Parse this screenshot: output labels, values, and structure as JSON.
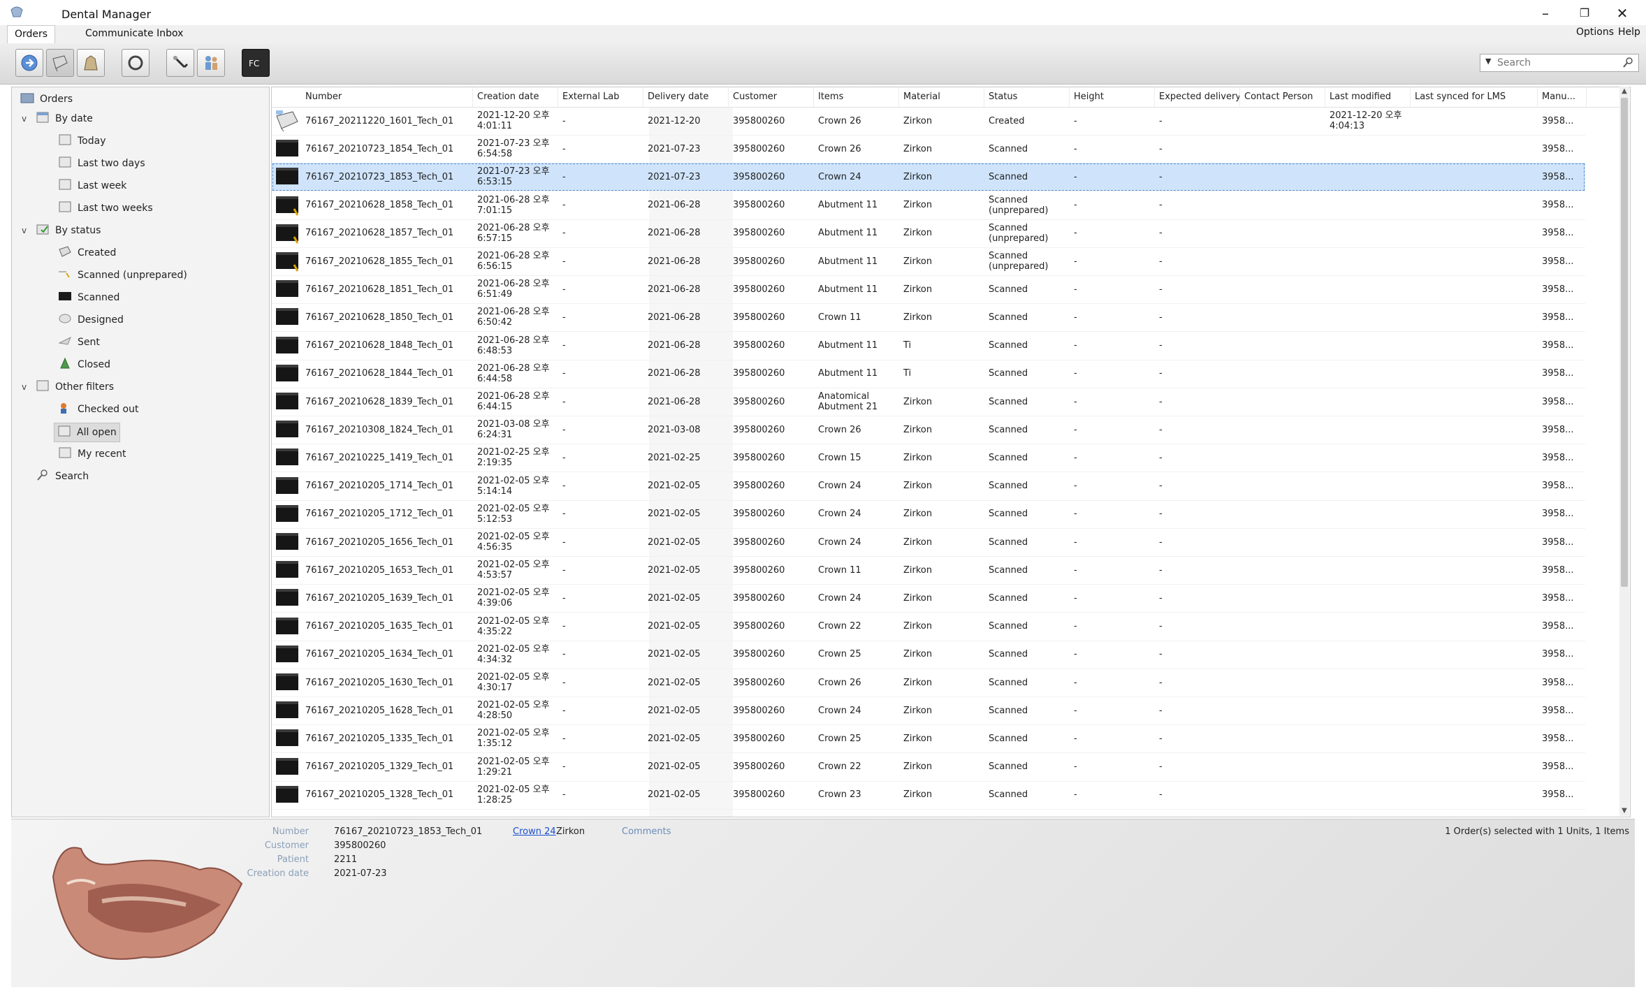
{
  "app": {
    "title": "Dental Manager"
  },
  "tabs": [
    {
      "label": "Orders"
    },
    {
      "label": "Communicate Inbox"
    }
  ],
  "menu_right": [
    {
      "label": "Options"
    },
    {
      "label": "Help"
    }
  ],
  "search": {
    "placeholder": "Search"
  },
  "tree": {
    "root": "Orders",
    "by_date": {
      "label": "By date",
      "items": [
        "Today",
        "Last two days",
        "Last week",
        "Last two weeks"
      ]
    },
    "by_status": {
      "label": "By status",
      "items": [
        "Created",
        "Scanned (unprepared)",
        "Scanned",
        "Designed",
        "Sent",
        "Closed"
      ]
    },
    "other_filters": {
      "label": "Other filters",
      "items": [
        "Checked out",
        "All open",
        "My recent"
      ]
    },
    "search": "Search"
  },
  "columns": [
    "Number",
    "Creation date",
    "External Lab",
    "Delivery date",
    "Customer",
    "Items",
    "Material",
    "Status",
    "Height",
    "Expected delivery",
    "Contact Person",
    "Last modified",
    "Last synced for LMS",
    "Manu..."
  ],
  "rows": [
    {
      "number": "76167_20211220_1601_Tech_01",
      "created": "2021-12-20 오후",
      "created_time": "4:01:11",
      "lab": "-",
      "delivery": "2021-12-20",
      "customer": "395800260",
      "items": "Crown 26",
      "items2": "",
      "material": "Zirkon",
      "status": "Created",
      "status2": "",
      "height": "-",
      "expected": "-",
      "modified": "2021-12-20 오후",
      "modified_time": "4:04:13",
      "manu": "3958...",
      "icon": "created"
    },
    {
      "number": "76167_20210723_1854_Tech_01",
      "created": "2021-07-23 오후",
      "created_time": "6:54:58",
      "lab": "-",
      "delivery": "2021-07-23",
      "customer": "395800260",
      "items": "Crown 26",
      "items2": "",
      "material": "Zirkon",
      "status": "Scanned",
      "status2": "",
      "height": "-",
      "expected": "-",
      "modified": "",
      "modified_time": "",
      "manu": "3958...",
      "icon": "scanned"
    },
    {
      "number": "76167_20210723_1853_Tech_01",
      "created": "2021-07-23 오후",
      "created_time": "6:53:15",
      "lab": "-",
      "delivery": "2021-07-23",
      "customer": "395800260",
      "items": "Crown 24",
      "items2": "",
      "material": "Zirkon",
      "status": "Scanned",
      "status2": "",
      "height": "-",
      "expected": "-",
      "modified": "",
      "modified_time": "",
      "manu": "3958...",
      "icon": "scanned",
      "selected": true
    },
    {
      "number": "76167_20210628_1858_Tech_01",
      "created": "2021-06-28 오후",
      "created_time": "7:01:15",
      "lab": "-",
      "delivery": "2021-06-28",
      "customer": "395800260",
      "items": "Abutment 11",
      "items2": "",
      "material": "Zirkon",
      "status": "Scanned",
      "status2": "(unprepared)",
      "height": "-",
      "expected": "-",
      "modified": "",
      "modified_time": "",
      "manu": "3958...",
      "icon": "unprepared"
    },
    {
      "number": "76167_20210628_1857_Tech_01",
      "created": "2021-06-28 오후",
      "created_time": "6:57:15",
      "lab": "-",
      "delivery": "2021-06-28",
      "customer": "395800260",
      "items": "Abutment 11",
      "items2": "",
      "material": "Zirkon",
      "status": "Scanned",
      "status2": "(unprepared)",
      "height": "-",
      "expected": "-",
      "modified": "",
      "modified_time": "",
      "manu": "3958...",
      "icon": "unprepared"
    },
    {
      "number": "76167_20210628_1855_Tech_01",
      "created": "2021-06-28 오후",
      "created_time": "6:56:15",
      "lab": "-",
      "delivery": "2021-06-28",
      "customer": "395800260",
      "items": "Abutment 11",
      "items2": "",
      "material": "Zirkon",
      "status": "Scanned",
      "status2": "(unprepared)",
      "height": "-",
      "expected": "-",
      "modified": "",
      "modified_time": "",
      "manu": "3958...",
      "icon": "unprepared"
    },
    {
      "number": "76167_20210628_1851_Tech_01",
      "created": "2021-06-28 오후",
      "created_time": "6:51:49",
      "lab": "-",
      "delivery": "2021-06-28",
      "customer": "395800260",
      "items": "Abutment 11",
      "items2": "",
      "material": "Zirkon",
      "status": "Scanned",
      "status2": "",
      "height": "-",
      "expected": "-",
      "modified": "",
      "modified_time": "",
      "manu": "3958...",
      "icon": "scanned"
    },
    {
      "number": "76167_20210628_1850_Tech_01",
      "created": "2021-06-28 오후",
      "created_time": "6:50:42",
      "lab": "-",
      "delivery": "2021-06-28",
      "customer": "395800260",
      "items": "Crown 11",
      "items2": "",
      "material": "Zirkon",
      "status": "Scanned",
      "status2": "",
      "height": "-",
      "expected": "-",
      "modified": "",
      "modified_time": "",
      "manu": "3958...",
      "icon": "scanned"
    },
    {
      "number": "76167_20210628_1848_Tech_01",
      "created": "2021-06-28 오후",
      "created_time": "6:48:53",
      "lab": "-",
      "delivery": "2021-06-28",
      "customer": "395800260",
      "items": "Abutment 11",
      "items2": "",
      "material": "Ti",
      "status": "Scanned",
      "status2": "",
      "height": "-",
      "expected": "-",
      "modified": "",
      "modified_time": "",
      "manu": "3958...",
      "icon": "scanned"
    },
    {
      "number": "76167_20210628_1844_Tech_01",
      "created": "2021-06-28 오후",
      "created_time": "6:44:58",
      "lab": "-",
      "delivery": "2021-06-28",
      "customer": "395800260",
      "items": "Abutment 11",
      "items2": "",
      "material": "Ti",
      "status": "Scanned",
      "status2": "",
      "height": "-",
      "expected": "-",
      "modified": "",
      "modified_time": "",
      "manu": "3958...",
      "icon": "scanned"
    },
    {
      "number": "76167_20210628_1839_Tech_01",
      "created": "2021-06-28 오후",
      "created_time": "6:44:15",
      "lab": "-",
      "delivery": "2021-06-28",
      "customer": "395800260",
      "items": "Anatomical",
      "items2": "Abutment 21",
      "material": "Zirkon",
      "status": "Scanned",
      "status2": "",
      "height": "-",
      "expected": "-",
      "modified": "",
      "modified_time": "",
      "manu": "3958...",
      "icon": "scanned"
    },
    {
      "number": "76167_20210308_1824_Tech_01",
      "created": "2021-03-08 오후",
      "created_time": "6:24:31",
      "lab": "-",
      "delivery": "2021-03-08",
      "customer": "395800260",
      "items": "Crown 26",
      "items2": "",
      "material": "Zirkon",
      "status": "Scanned",
      "status2": "",
      "height": "-",
      "expected": "-",
      "modified": "",
      "modified_time": "",
      "manu": "3958...",
      "icon": "scanned"
    },
    {
      "number": "76167_20210225_1419_Tech_01",
      "created": "2021-02-25 오후",
      "created_time": "2:19:35",
      "lab": "-",
      "delivery": "2021-02-25",
      "customer": "395800260",
      "items": "Crown 15",
      "items2": "",
      "material": "Zirkon",
      "status": "Scanned",
      "status2": "",
      "height": "-",
      "expected": "-",
      "modified": "",
      "modified_time": "",
      "manu": "3958...",
      "icon": "scanned"
    },
    {
      "number": "76167_20210205_1714_Tech_01",
      "created": "2021-02-05 오후",
      "created_time": "5:14:14",
      "lab": "-",
      "delivery": "2021-02-05",
      "customer": "395800260",
      "items": "Crown 24",
      "items2": "",
      "material": "Zirkon",
      "status": "Scanned",
      "status2": "",
      "height": "-",
      "expected": "-",
      "modified": "",
      "modified_time": "",
      "manu": "3958...",
      "icon": "scanned"
    },
    {
      "number": "76167_20210205_1712_Tech_01",
      "created": "2021-02-05 오후",
      "created_time": "5:12:53",
      "lab": "-",
      "delivery": "2021-02-05",
      "customer": "395800260",
      "items": "Crown 24",
      "items2": "",
      "material": "Zirkon",
      "status": "Scanned",
      "status2": "",
      "height": "-",
      "expected": "-",
      "modified": "",
      "modified_time": "",
      "manu": "3958...",
      "icon": "scanned"
    },
    {
      "number": "76167_20210205_1656_Tech_01",
      "created": "2021-02-05 오후",
      "created_time": "4:56:35",
      "lab": "-",
      "delivery": "2021-02-05",
      "customer": "395800260",
      "items": "Crown 24",
      "items2": "",
      "material": "Zirkon",
      "status": "Scanned",
      "status2": "",
      "height": "-",
      "expected": "-",
      "modified": "",
      "modified_time": "",
      "manu": "3958...",
      "icon": "scanned"
    },
    {
      "number": "76167_20210205_1653_Tech_01",
      "created": "2021-02-05 오후",
      "created_time": "4:53:57",
      "lab": "-",
      "delivery": "2021-02-05",
      "customer": "395800260",
      "items": "Crown 11",
      "items2": "",
      "material": "Zirkon",
      "status": "Scanned",
      "status2": "",
      "height": "-",
      "expected": "-",
      "modified": "",
      "modified_time": "",
      "manu": "3958...",
      "icon": "scanned"
    },
    {
      "number": "76167_20210205_1639_Tech_01",
      "created": "2021-02-05 오후",
      "created_time": "4:39:06",
      "lab": "-",
      "delivery": "2021-02-05",
      "customer": "395800260",
      "items": "Crown 24",
      "items2": "",
      "material": "Zirkon",
      "status": "Scanned",
      "status2": "",
      "height": "-",
      "expected": "-",
      "modified": "",
      "modified_time": "",
      "manu": "3958...",
      "icon": "scanned"
    },
    {
      "number": "76167_20210205_1635_Tech_01",
      "created": "2021-02-05 오후",
      "created_time": "4:35:22",
      "lab": "-",
      "delivery": "2021-02-05",
      "customer": "395800260",
      "items": "Crown 22",
      "items2": "",
      "material": "Zirkon",
      "status": "Scanned",
      "status2": "",
      "height": "-",
      "expected": "-",
      "modified": "",
      "modified_time": "",
      "manu": "3958...",
      "icon": "scanned"
    },
    {
      "number": "76167_20210205_1634_Tech_01",
      "created": "2021-02-05 오후",
      "created_time": "4:34:32",
      "lab": "-",
      "delivery": "2021-02-05",
      "customer": "395800260",
      "items": "Crown 25",
      "items2": "",
      "material": "Zirkon",
      "status": "Scanned",
      "status2": "",
      "height": "-",
      "expected": "-",
      "modified": "",
      "modified_time": "",
      "manu": "3958...",
      "icon": "scanned"
    },
    {
      "number": "76167_20210205_1630_Tech_01",
      "created": "2021-02-05 오후",
      "created_time": "4:30:17",
      "lab": "-",
      "delivery": "2021-02-05",
      "customer": "395800260",
      "items": "Crown 26",
      "items2": "",
      "material": "Zirkon",
      "status": "Scanned",
      "status2": "",
      "height": "-",
      "expected": "-",
      "modified": "",
      "modified_time": "",
      "manu": "3958...",
      "icon": "scanned"
    },
    {
      "number": "76167_20210205_1628_Tech_01",
      "created": "2021-02-05 오후",
      "created_time": "4:28:50",
      "lab": "-",
      "delivery": "2021-02-05",
      "customer": "395800260",
      "items": "Crown 24",
      "items2": "",
      "material": "Zirkon",
      "status": "Scanned",
      "status2": "",
      "height": "-",
      "expected": "-",
      "modified": "",
      "modified_time": "",
      "manu": "3958...",
      "icon": "scanned"
    },
    {
      "number": "76167_20210205_1335_Tech_01",
      "created": "2021-02-05 오후",
      "created_time": "1:35:12",
      "lab": "-",
      "delivery": "2021-02-05",
      "customer": "395800260",
      "items": "Crown 25",
      "items2": "",
      "material": "Zirkon",
      "status": "Scanned",
      "status2": "",
      "height": "-",
      "expected": "-",
      "modified": "",
      "modified_time": "",
      "manu": "3958...",
      "icon": "scanned"
    },
    {
      "number": "76167_20210205_1329_Tech_01",
      "created": "2021-02-05 오후",
      "created_time": "1:29:21",
      "lab": "-",
      "delivery": "2021-02-05",
      "customer": "395800260",
      "items": "Crown 22",
      "items2": "",
      "material": "Zirkon",
      "status": "Scanned",
      "status2": "",
      "height": "-",
      "expected": "-",
      "modified": "",
      "modified_time": "",
      "manu": "3958...",
      "icon": "scanned"
    },
    {
      "number": "76167_20210205_1328_Tech_01",
      "created": "2021-02-05 오후",
      "created_time": "1:28:25",
      "lab": "-",
      "delivery": "2021-02-05",
      "customer": "395800260",
      "items": "Crown 23",
      "items2": "",
      "material": "Zirkon",
      "status": "Scanned",
      "status2": "",
      "height": "-",
      "expected": "-",
      "modified": "",
      "modified_time": "",
      "manu": "3958...",
      "icon": "scanned"
    }
  ],
  "detail": {
    "labels": {
      "number": "Number",
      "customer": "Customer",
      "patient": "Patient",
      "created": "Creation date"
    },
    "number": "76167_20210723_1853_Tech_01",
    "customer": "395800260",
    "patient": "2211",
    "created": "2021-07-23",
    "item_link": "Crown 24",
    "material": "Zirkon",
    "comments": "Comments",
    "summary": "1 Order(s) selected with 1 Units, 1 Items"
  },
  "colors": {
    "selection": "#cfe4fb",
    "link": "#1a4fd1",
    "label": "#8aa0b8"
  }
}
